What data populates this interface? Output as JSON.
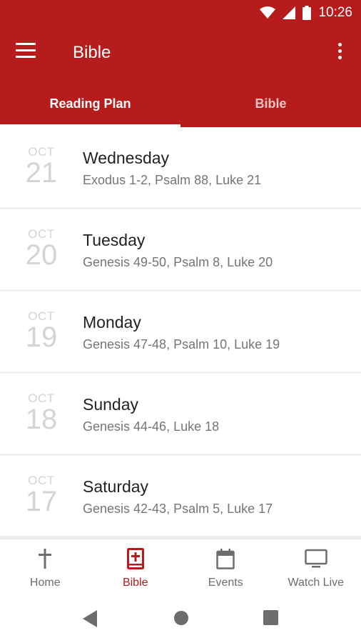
{
  "status_bar": {
    "time": "10:26"
  },
  "app_bar": {
    "title": "Bible"
  },
  "tabs": [
    {
      "label": "Reading Plan",
      "active": true
    },
    {
      "label": "Bible",
      "active": false
    }
  ],
  "readings": [
    {
      "month": "OCT",
      "day": "21",
      "weekday": "Wednesday",
      "passages": "Exodus 1-2, Psalm 88, Luke 21"
    },
    {
      "month": "OCT",
      "day": "20",
      "weekday": "Tuesday",
      "passages": "Genesis 49-50, Psalm 8, Luke 20"
    },
    {
      "month": "OCT",
      "day": "19",
      "weekday": "Monday",
      "passages": "Genesis 47-48, Psalm 10, Luke 19"
    },
    {
      "month": "OCT",
      "day": "18",
      "weekday": "Sunday",
      "passages": "Genesis 44-46, Luke 18"
    },
    {
      "month": "OCT",
      "day": "17",
      "weekday": "Saturday",
      "passages": "Genesis 42-43, Psalm 5, Luke 17"
    }
  ],
  "bottom_nav": [
    {
      "label": "Home",
      "icon": "cross-icon",
      "active": false
    },
    {
      "label": "Bible",
      "icon": "bible-icon",
      "active": true
    },
    {
      "label": "Events",
      "icon": "calendar-icon",
      "active": false
    },
    {
      "label": "Watch Live",
      "icon": "tv-icon",
      "active": false
    }
  ],
  "colors": {
    "primary": "#b71c1c",
    "date_text": "#d4d4d4",
    "secondary_text": "#757575"
  }
}
